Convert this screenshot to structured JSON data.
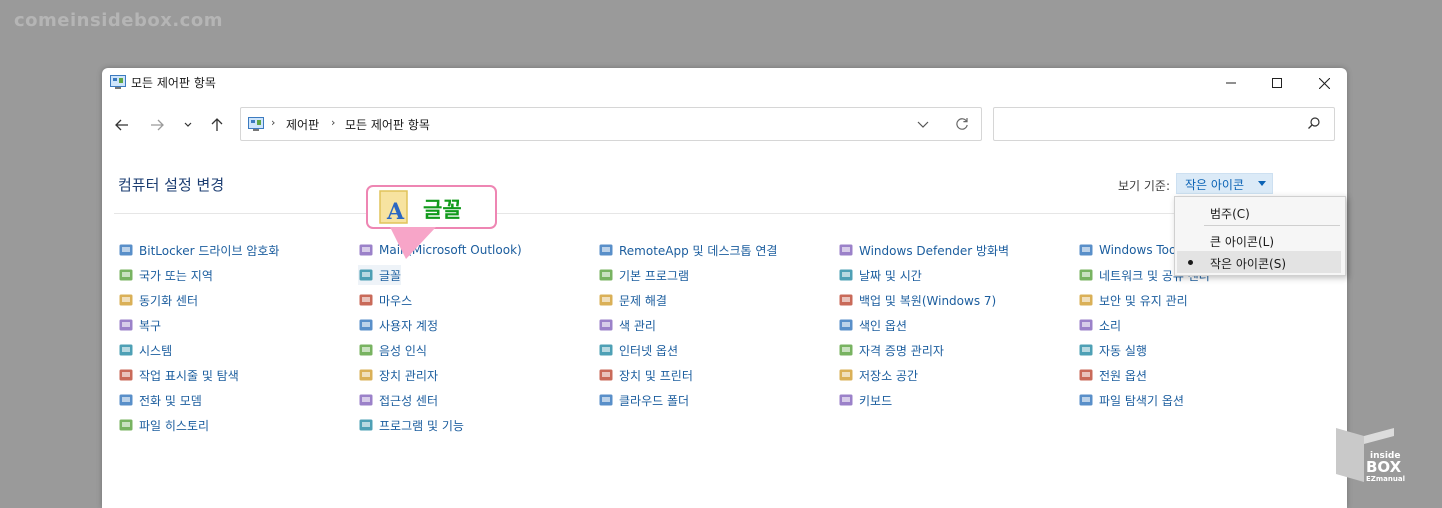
{
  "watermark": "comeinsidebox.com",
  "window": {
    "title": "모든 제어판 항목",
    "breadcrumbs": [
      "제어판",
      "모든 제어판 항목"
    ],
    "search_placeholder": ""
  },
  "heading": "컴퓨터 설정 변경",
  "view_by": {
    "label": "보기 기준:",
    "selected": "작은 아이콘",
    "options": [
      "범주(C)",
      "큰 아이콘(L)",
      "작은 아이콘(S)"
    ]
  },
  "callout": {
    "text": "글꼴"
  },
  "columns": [
    [
      {
        "label": "BitLocker 드라이브 암호화",
        "icon": "bitlocker-icon"
      },
      {
        "label": "국가 또는 지역",
        "icon": "region-icon"
      },
      {
        "label": "동기화 센터",
        "icon": "sync-center-icon"
      },
      {
        "label": "복구",
        "icon": "recovery-icon"
      },
      {
        "label": "시스템",
        "icon": "system-icon"
      },
      {
        "label": "작업 표시줄 및 탐색",
        "icon": "taskbar-icon"
      },
      {
        "label": "전화 및 모뎀",
        "icon": "phone-modem-icon"
      },
      {
        "label": "파일 히스토리",
        "icon": "file-history-icon"
      }
    ],
    [
      {
        "label": "Mail (Microsoft Outlook)",
        "icon": "mail-icon"
      },
      {
        "label": "글꼴",
        "icon": "fonts-icon"
      },
      {
        "label": "마우스",
        "icon": "mouse-icon"
      },
      {
        "label": "사용자 계정",
        "icon": "user-accounts-icon"
      },
      {
        "label": "음성 인식",
        "icon": "speech-icon"
      },
      {
        "label": "장치 관리자",
        "icon": "device-manager-icon"
      },
      {
        "label": "접근성 센터",
        "icon": "ease-of-access-icon"
      },
      {
        "label": "프로그램 및 기능",
        "icon": "programs-icon"
      }
    ],
    [
      {
        "label": "RemoteApp 및 데스크톱 연결",
        "icon": "remoteapp-icon"
      },
      {
        "label": "기본 프로그램",
        "icon": "default-programs-icon"
      },
      {
        "label": "문제 해결",
        "icon": "troubleshoot-icon"
      },
      {
        "label": "색 관리",
        "icon": "color-management-icon"
      },
      {
        "label": "인터넷 옵션",
        "icon": "internet-options-icon"
      },
      {
        "label": "장치 및 프린터",
        "icon": "devices-printers-icon"
      },
      {
        "label": "클라우드 폴더",
        "icon": "work-folders-icon"
      }
    ],
    [
      {
        "label": "Windows Defender 방화벽",
        "icon": "firewall-icon"
      },
      {
        "label": "날짜 및 시간",
        "icon": "date-time-icon"
      },
      {
        "label": "백업 및 복원(Windows 7)",
        "icon": "backup-icon"
      },
      {
        "label": "색인 옵션",
        "icon": "indexing-icon"
      },
      {
        "label": "자격 증명 관리자",
        "icon": "credential-icon"
      },
      {
        "label": "저장소 공간",
        "icon": "storage-spaces-icon"
      },
      {
        "label": "키보드",
        "icon": "keyboard-icon"
      }
    ],
    [
      {
        "label": "Windows Tools",
        "icon": "windows-tools-icon"
      },
      {
        "label": "네트워크 및 공유 센터",
        "icon": "network-icon"
      },
      {
        "label": "보안 및 유지 관리",
        "icon": "security-icon"
      },
      {
        "label": "소리",
        "icon": "sound-icon"
      },
      {
        "label": "자동 실행",
        "icon": "autoplay-icon"
      },
      {
        "label": "전원 옵션",
        "icon": "power-icon"
      },
      {
        "label": "파일 탐색기 옵션",
        "icon": "explorer-options-icon"
      }
    ]
  ],
  "logo": {
    "line1": "inside",
    "line2": "BOX",
    "line3": "EZmanual"
  },
  "colors": {
    "link": "#1b5d9e",
    "heading": "#1e3f73",
    "callout_border": "#ee86b3",
    "callout_text": "#119a1b"
  }
}
